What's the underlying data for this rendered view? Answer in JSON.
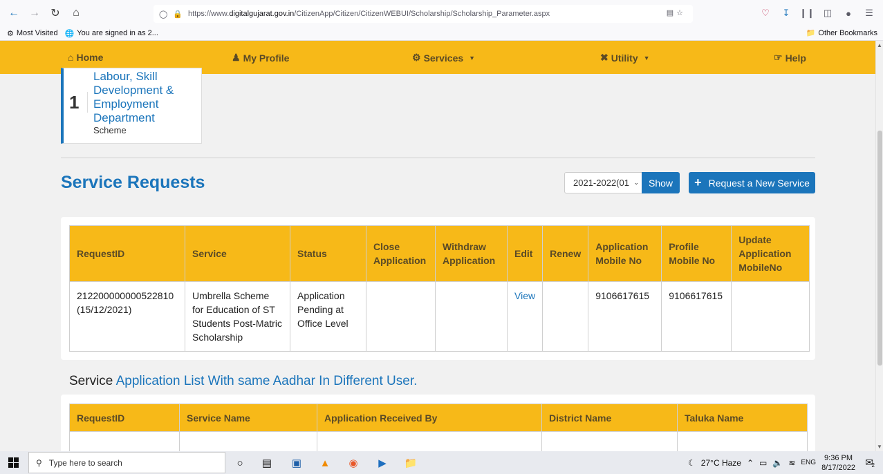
{
  "browser": {
    "url_prefix": "https://www.",
    "url_domain": "digitalgujarat.gov.in",
    "url_path": "/CitizenApp/Citizen/CitizenWEBUI/Scholarship/Scholarship_Parameter.aspx",
    "bookmarks": [
      {
        "label": "Most Visited"
      },
      {
        "label": "You are signed in as 2..."
      }
    ],
    "other_bookmarks": "Other Bookmarks"
  },
  "nav": {
    "home": "Home",
    "profile": "My Profile",
    "services": "Services",
    "utility": "Utility",
    "help": "Help"
  },
  "dept_card": {
    "number": "1",
    "department": "Labour, Skill Development & Employment Department",
    "subtitle": "Scheme"
  },
  "service_requests": {
    "title": "Service Requests",
    "year_selected": "2021-2022(01",
    "show_label": "Show",
    "request_new_label": "Request a New Service",
    "headers": [
      "RequestID",
      "Service",
      "Status",
      "Close Application",
      "Withdraw Application",
      "Edit",
      "Renew",
      "Application Mobile No",
      "Profile Mobile No",
      "Update Application MobileNo"
    ],
    "rows": [
      {
        "request_id": "212200000000522810 (15/12/2021)",
        "service": "Umbrella Scheme for Education of ST Students Post-Matric Scholarship",
        "status": "Application Pending at Office Level",
        "close": "",
        "withdraw": "",
        "edit": "View",
        "renew": "",
        "app_mobile": "9106617615",
        "profile_mobile": "9106617615",
        "update_mobile": ""
      }
    ]
  },
  "aadhar_section": {
    "prefix": "Service",
    "link_text": "Application List With same Aadhar In Different User.",
    "headers": [
      "RequestID",
      "Service Name",
      "Application Received By",
      "District Name",
      "Taluka Name"
    ]
  },
  "taskbar": {
    "search_placeholder": "Type here to search",
    "weather": "27°C  Haze",
    "language": "ENG",
    "time": "9:36 PM",
    "date": "8/17/2022",
    "notification_count": "2"
  }
}
